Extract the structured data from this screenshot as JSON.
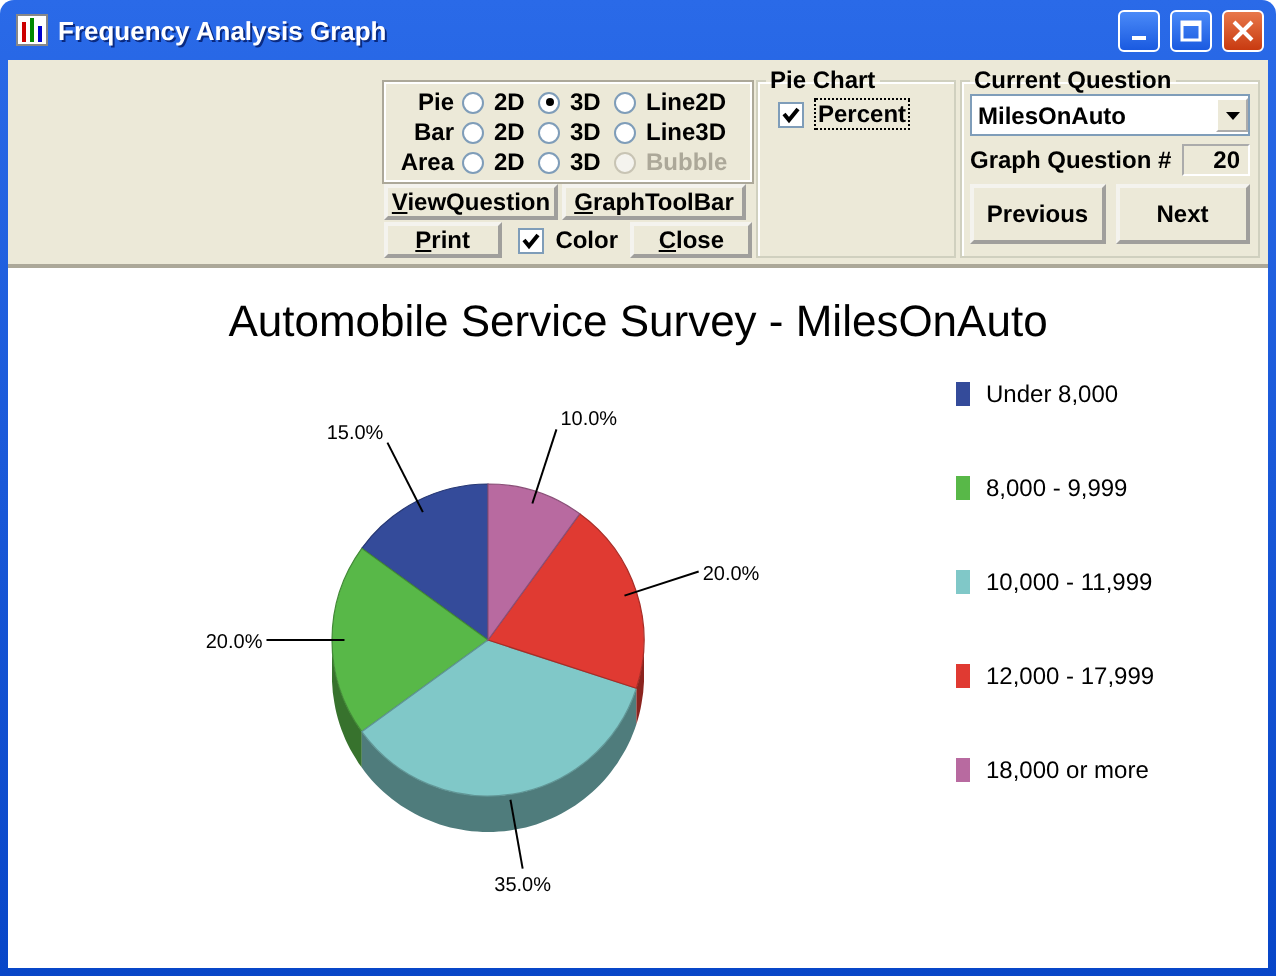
{
  "window": {
    "title": "Frequency Analysis Graph"
  },
  "graph_type": {
    "rows": [
      {
        "label": "Pie",
        "options": [
          {
            "label": "2D",
            "selected": false,
            "disabled": false
          },
          {
            "label": "3D",
            "selected": true,
            "disabled": false
          },
          {
            "label": "Line2D",
            "selected": false,
            "disabled": false
          }
        ]
      },
      {
        "label": "Bar",
        "options": [
          {
            "label": "2D",
            "selected": false,
            "disabled": false
          },
          {
            "label": "3D",
            "selected": false,
            "disabled": false
          },
          {
            "label": "Line3D",
            "selected": false,
            "disabled": false
          }
        ]
      },
      {
        "label": "Area",
        "options": [
          {
            "label": "2D",
            "selected": false,
            "disabled": false
          },
          {
            "label": "3D",
            "selected": false,
            "disabled": false
          },
          {
            "label": "Bubble",
            "selected": false,
            "disabled": true
          }
        ]
      }
    ]
  },
  "view_buttons": [
    "ViewQuestion",
    "GraphToolBar"
  ],
  "print_button": "Print",
  "color_checkbox": {
    "label": "Color",
    "checked": true
  },
  "close_button": "Close",
  "pie_chart": {
    "title": "Pie Chart",
    "percent": {
      "label": "Percent",
      "checked": true
    }
  },
  "current_question": {
    "title": "Current Question",
    "value": "MilesOnAuto",
    "graph_question_label": "Graph Question #",
    "graph_question_number": "20",
    "buttons": [
      "Previous",
      "Next"
    ]
  },
  "chart_data": {
    "type": "pie",
    "title": "Automobile Service Survey - MilesOnAuto",
    "categories": [
      "Under 8,000",
      "8,000 - 9,999",
      "10,000 - 11,999",
      "12,000 - 17,999",
      "18,000 or more"
    ],
    "values": [
      15,
      20,
      35,
      20,
      10
    ],
    "value_labels": [
      "15.0%",
      "20.0%",
      "35.0%",
      "20.0%",
      "10.0%"
    ],
    "colors": [
      "#344b9a",
      "#58b848",
      "#80c8c8",
      "#e03a32",
      "#b86aa0"
    ]
  }
}
